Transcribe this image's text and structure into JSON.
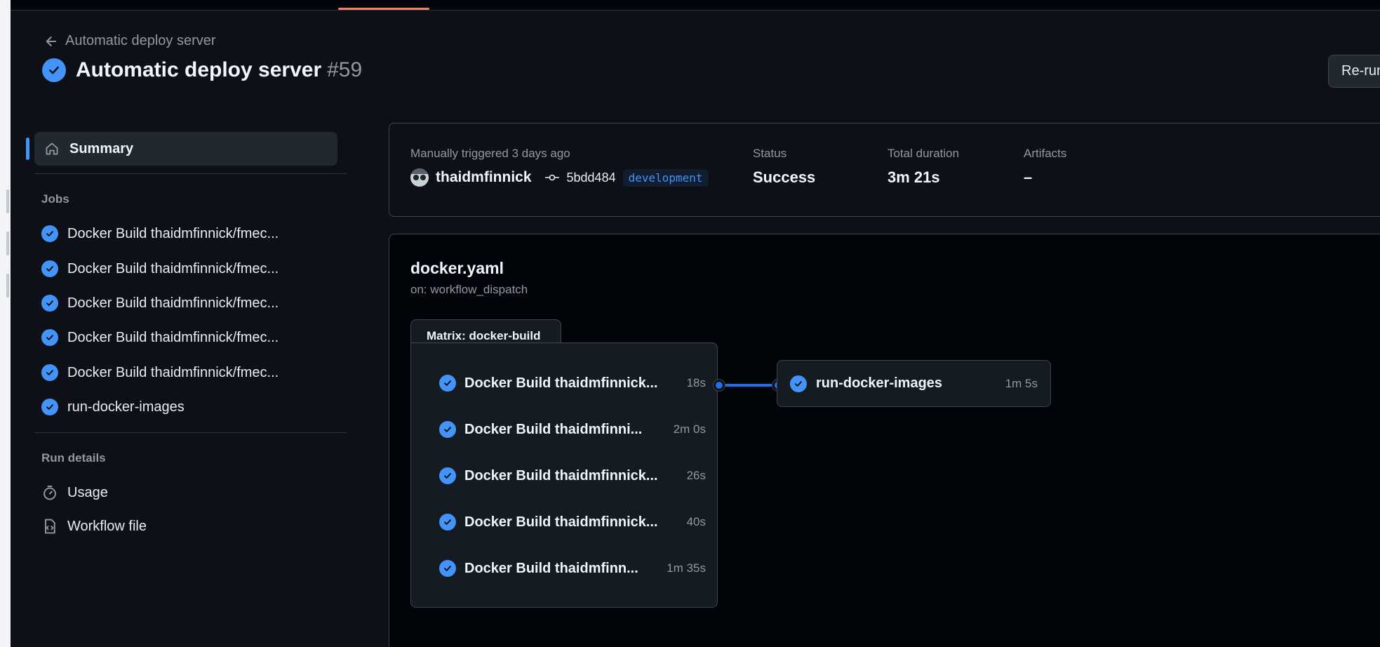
{
  "header": {
    "back_label": "Automatic deploy server",
    "title": "Automatic deploy server",
    "run_number": "#59",
    "rerun_label": "Re-run"
  },
  "sidebar": {
    "summary_label": "Summary",
    "jobs_title": "Jobs",
    "jobs": [
      {
        "label": "Docker Build thaidmfinnick/fmec..."
      },
      {
        "label": "Docker Build thaidmfinnick/fmec..."
      },
      {
        "label": "Docker Build thaidmfinnick/fmec..."
      },
      {
        "label": "Docker Build thaidmfinnick/fmec..."
      },
      {
        "label": "Docker Build thaidmfinnick/fmec..."
      },
      {
        "label": "run-docker-images"
      }
    ],
    "run_details_title": "Run details",
    "usage_label": "Usage",
    "workflow_file_label": "Workflow file"
  },
  "summary": {
    "trigger_label": "Manually triggered 3 days ago",
    "actor": "thaidmfinnick",
    "commit_sha": "5bdd484",
    "branch": "development",
    "status_label": "Status",
    "status_value": "Success",
    "duration_label": "Total duration",
    "duration_value": "3m 21s",
    "artifacts_label": "Artifacts",
    "artifacts_value": "–"
  },
  "graph": {
    "workflow_file": "docker.yaml",
    "trigger": "on: workflow_dispatch",
    "matrix_title": "Matrix: docker-build",
    "matrix_jobs": [
      {
        "label": "Docker Build thaidmfinnick...",
        "duration": "18s"
      },
      {
        "label": "Docker Build thaidmfinni...",
        "duration": "2m 0s"
      },
      {
        "label": "Docker Build thaidmfinnick...",
        "duration": "26s"
      },
      {
        "label": "Docker Build thaidmfinnick...",
        "duration": "40s"
      },
      {
        "label": "Docker Build thaidmfinn...",
        "duration": "1m 35s"
      }
    ],
    "run_job": {
      "label": "run-docker-images",
      "duration": "1m 5s"
    }
  },
  "colors": {
    "accent": "#4493f8",
    "success": "#4493f8",
    "tab_underline": "#f78166",
    "background": "#0d1117"
  }
}
